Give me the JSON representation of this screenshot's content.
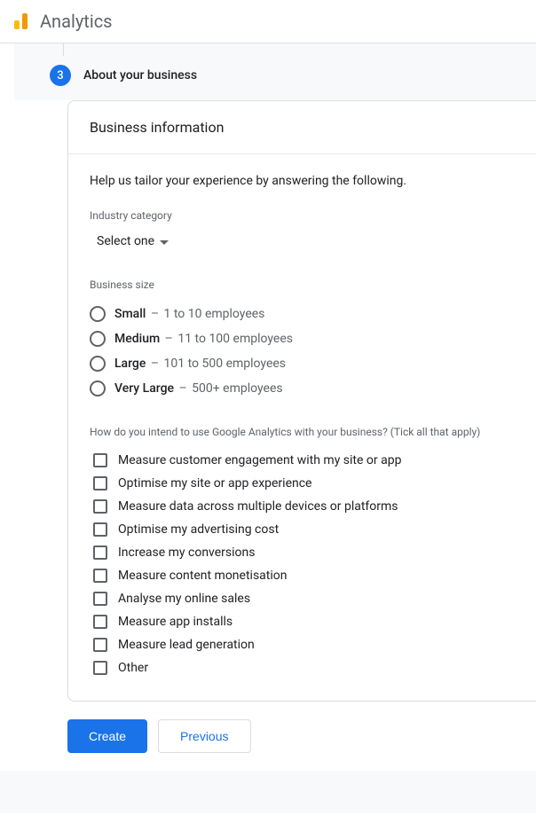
{
  "header": {
    "title": "Analytics"
  },
  "step": {
    "number": "3",
    "label": "About your business"
  },
  "card": {
    "title": "Business information",
    "intro": "Help us tailor your experience by answering the following.",
    "industry_label": "Industry category",
    "industry_placeholder": "Select one",
    "size_label": "Business size",
    "sizes": [
      {
        "name": "Small",
        "desc": "1 to 10 employees"
      },
      {
        "name": "Medium",
        "desc": "11 to 100 employees"
      },
      {
        "name": "Large",
        "desc": "101 to 500 employees"
      },
      {
        "name": "Very Large",
        "desc": "500+ employees"
      }
    ],
    "intent_label": "How do you intend to use Google Analytics with your business? (Tick all that apply)",
    "intents": [
      "Measure customer engagement with my site or app",
      "Optimise my site or app experience",
      "Measure data across multiple devices or platforms",
      "Optimise my advertising cost",
      "Increase my conversions",
      "Measure content monetisation",
      "Analyse my online sales",
      "Measure app installs",
      "Measure lead generation",
      "Other"
    ]
  },
  "actions": {
    "create": "Create",
    "previous": "Previous"
  }
}
